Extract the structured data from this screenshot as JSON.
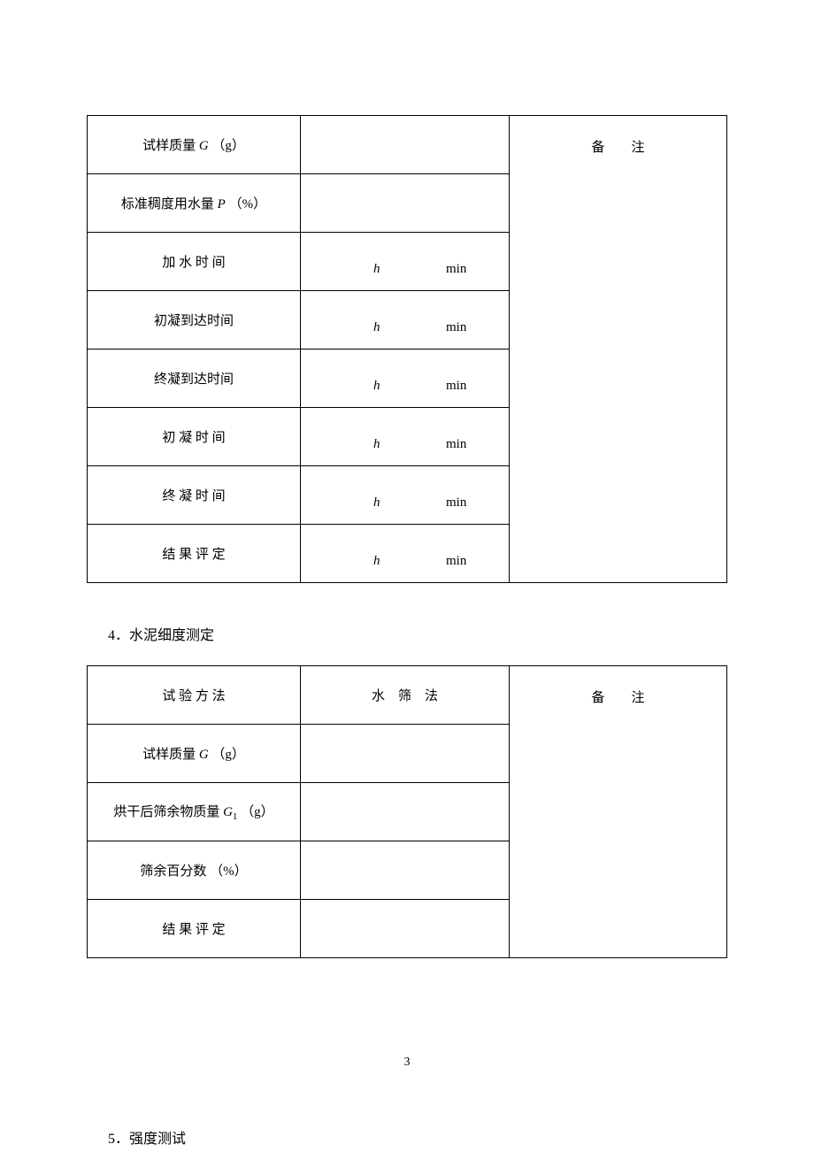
{
  "table1": {
    "rows": [
      {
        "label_pre": "试样质量 ",
        "label_var": "G",
        "label_post": " （g）",
        "h": "",
        "min": "",
        "show_time": false
      },
      {
        "label_pre": "标准稠度用水量 ",
        "label_var": "P",
        "label_post": " （%）",
        "h": "",
        "min": "",
        "show_time": false
      },
      {
        "label_pre": "",
        "label_var": "",
        "label_post": "加 水 时 间",
        "h": "h",
        "min": "min",
        "show_time": true
      },
      {
        "label_pre": "",
        "label_var": "",
        "label_post": "初凝到达时间",
        "h": "h",
        "min": "min",
        "show_time": true
      },
      {
        "label_pre": "",
        "label_var": "",
        "label_post": "终凝到达时间",
        "h": "h",
        "min": "min",
        "show_time": true
      },
      {
        "label_pre": "",
        "label_var": "",
        "label_post": "初 凝 时 间",
        "h": "h",
        "min": "min",
        "show_time": true
      },
      {
        "label_pre": "",
        "label_var": "",
        "label_post": "终 凝 时 间",
        "h": "h",
        "min": "min",
        "show_time": true
      },
      {
        "label_pre": "",
        "label_var": "",
        "label_post": "结 果 评 定",
        "h": "h",
        "min": "min",
        "show_time": true
      }
    ],
    "remark_label": "备　　注"
  },
  "section4": {
    "title": "4．水泥细度测定"
  },
  "table2": {
    "header": {
      "col1": "试 验 方 法",
      "col2": "水 筛 法",
      "col3": "备　　注"
    },
    "rows": [
      {
        "label_pre": "试样质量 ",
        "label_var": "G",
        "label_sub": "",
        "label_post": " （g）"
      },
      {
        "label_pre": "烘干后筛余物质量 ",
        "label_var": "G",
        "label_sub": "1",
        "label_post": " （g）"
      },
      {
        "label_pre": "",
        "label_var": "",
        "label_sub": "",
        "label_post": "筛余百分数 （%）"
      },
      {
        "label_pre": "",
        "label_var": "",
        "label_sub": "",
        "label_post": "结 果 评 定"
      }
    ]
  },
  "section5": {
    "title": "5．强度测试"
  },
  "page_number": "3"
}
